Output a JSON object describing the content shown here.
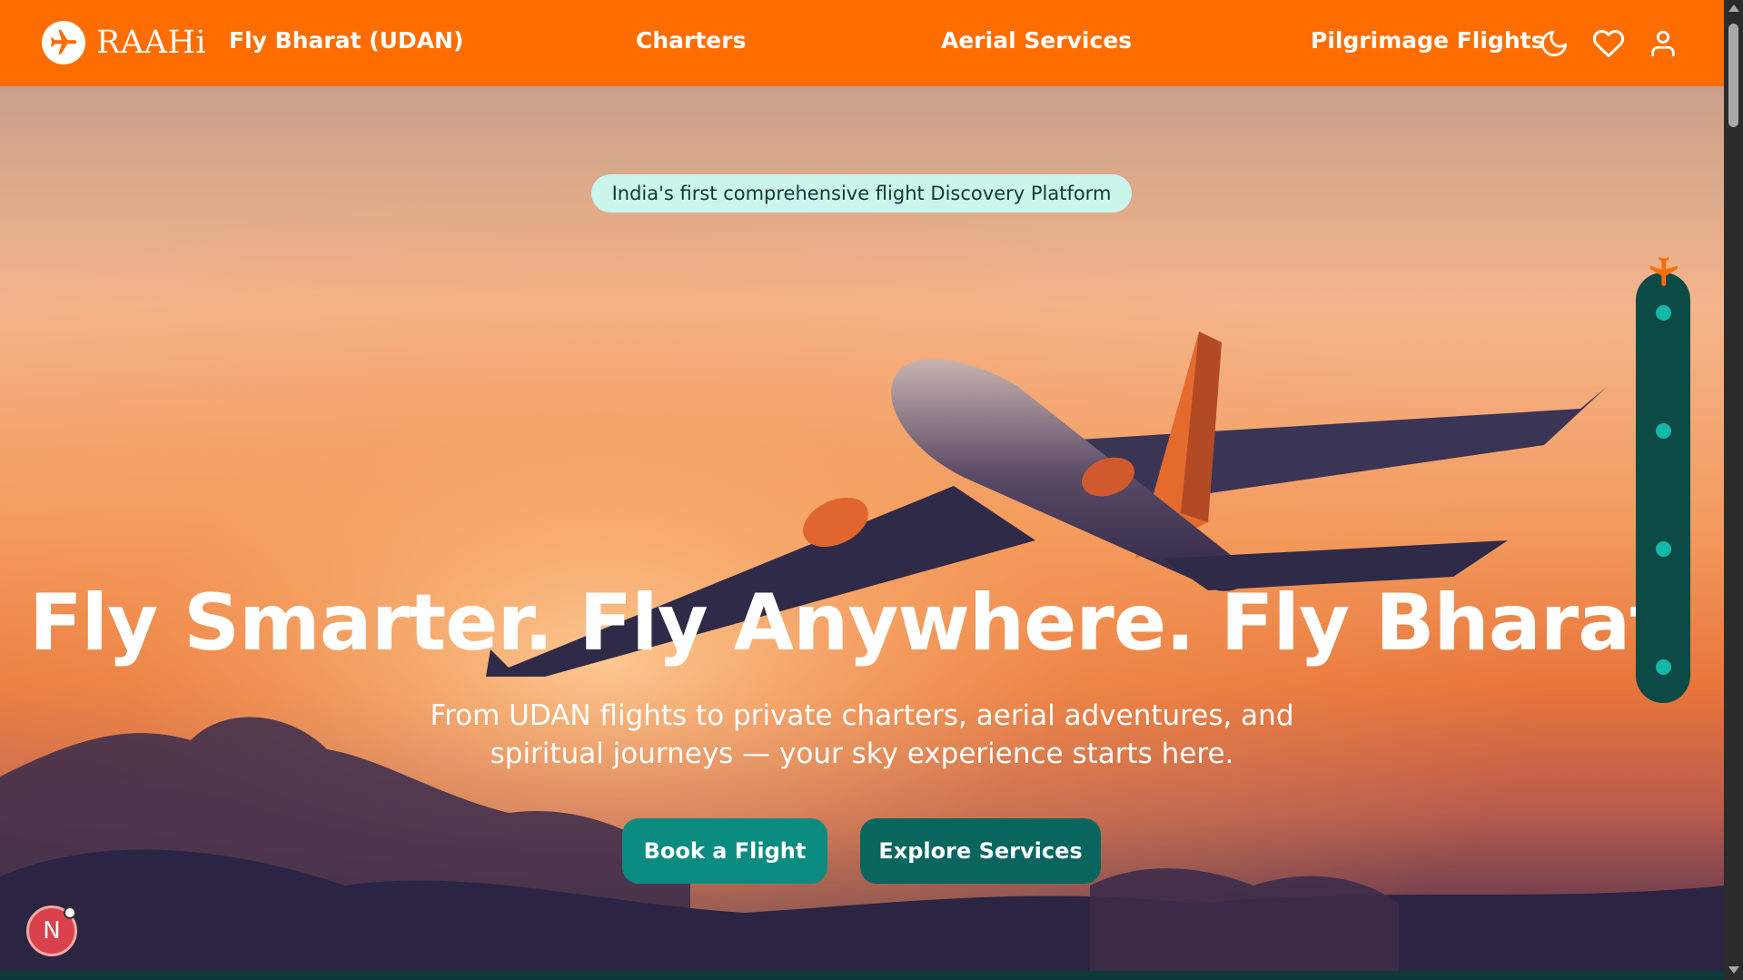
{
  "navbar": {
    "brand": "RAAHi",
    "brand_icon": "plane-icon",
    "links": [
      "Fly Bharat (UDAN)",
      "Charters",
      "Aerial Services",
      "Pilgrimage Flights"
    ],
    "icons": [
      "moon-icon",
      "heart-icon",
      "user-icon"
    ],
    "bg_color": "#ff6d00"
  },
  "hero": {
    "badge": "India's first comprehensive flight Discovery Platform",
    "headline": "Fly Smarter. Fly Anywhere. Fly Bharat.",
    "subtitle": "From UDAN flights to private charters, aerial adventures, and spiritual journeys — your sky experience starts here.",
    "primary_button": "Book a Flight",
    "secondary_button": "Explore Services",
    "accent_color": "#0a8c81"
  },
  "side_progress": {
    "dots": 4,
    "active_icon": "plane-icon"
  },
  "floating_avatar": {
    "letter": "N"
  }
}
